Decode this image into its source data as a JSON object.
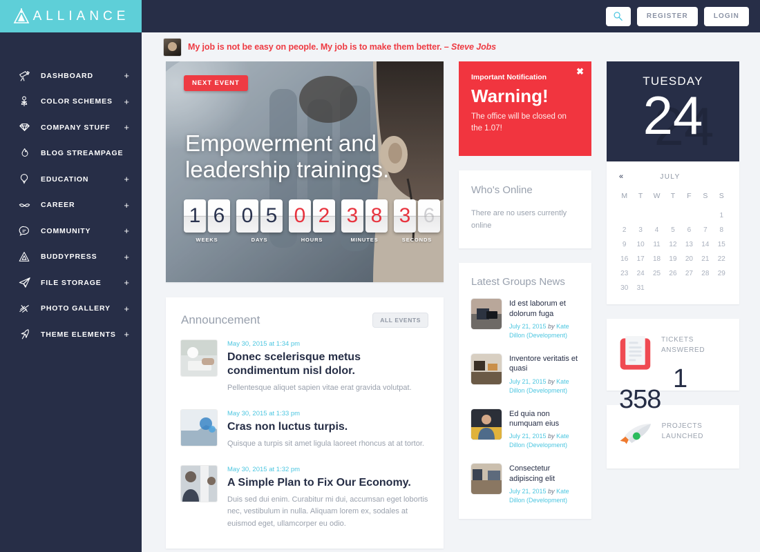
{
  "brand": {
    "name": "ALLIANCE",
    "accent": "#5ecfd8",
    "dark": "#272e47",
    "red": "#ee3b43",
    "cyan": "#4cc6e0"
  },
  "topbar": {
    "search_icon": "search-icon",
    "register_label": "REGISTER",
    "login_label": "LOGIN"
  },
  "sidebar": {
    "items": [
      {
        "label": "DASHBOARD",
        "icon": "telescope-icon",
        "plus": "+"
      },
      {
        "label": "COLOR SCHEMES",
        "icon": "flower-icon",
        "plus": "+"
      },
      {
        "label": "COMPANY STUFF",
        "icon": "diamond-icon",
        "plus": "+"
      },
      {
        "label": "BLOG STREAMPAGE",
        "icon": "flame-icon",
        "plus": ""
      },
      {
        "label": "EDUCATION",
        "icon": "balloon-icon",
        "plus": "+"
      },
      {
        "label": "CAREER",
        "icon": "mustache-icon",
        "plus": "+"
      },
      {
        "label": "COMMUNITY",
        "icon": "chat-bubble-icon",
        "plus": "+"
      },
      {
        "label": "BUDDYPRESS",
        "icon": "triangle-icon",
        "plus": "+"
      },
      {
        "label": "FILE STORAGE",
        "icon": "paper-plane-icon",
        "plus": "+"
      },
      {
        "label": "PHOTO GALLERY",
        "icon": "slashes-icon",
        "plus": "+"
      },
      {
        "label": "THEME ELEMENTS",
        "icon": "origami-bird-icon",
        "plus": "+"
      }
    ]
  },
  "quote": {
    "text": "My job is not be easy on people. My job is to make them better. – ",
    "author": "Steve Jobs"
  },
  "hero": {
    "badge": "NEXT EVENT",
    "title": "Empowerment and leadership trainings.",
    "counter": [
      {
        "label": "WEEKS",
        "digits": [
          "1",
          "6"
        ],
        "style": "dark"
      },
      {
        "label": "DAYS",
        "digits": [
          "0",
          "5"
        ],
        "style": "dark"
      },
      {
        "label": "HOURS",
        "digits": [
          "0",
          "2"
        ],
        "style": "red"
      },
      {
        "label": "MINUTES",
        "digits": [
          "3",
          "8"
        ],
        "style": "red"
      },
      {
        "label": "SECONDS",
        "digits": [
          "3",
          "6"
        ],
        "style": "red-flip"
      }
    ]
  },
  "announcement": {
    "title": "Announcement",
    "all_events_label": "ALL EVENTS",
    "posts": [
      {
        "date": "May 30, 2015 at 1:34 pm",
        "title": "Donec scelerisque metus condimentum nisl dolor.",
        "desc": "Pellentesque aliquet sapien vitae erat gravida volutpat."
      },
      {
        "date": "May 30, 2015 at 1:33 pm",
        "title": "Cras non luctus turpis.",
        "desc": "Quisque a turpis sit amet ligula laoreet rhoncus at at tortor."
      },
      {
        "date": "May 30, 2015 at 1:32 pm",
        "title": "A Simple Plan to Fix Our Economy.",
        "desc": "Duis sed dui enim. Curabitur mi dui, accumsan eget lobortis nec, vestibulum in nulla. Aliquam lorem ex, sodales at euismod eget, ullamcorper eu odio."
      }
    ]
  },
  "notification": {
    "kicker": "Important Notification",
    "title": "Warning!",
    "text": "The office will be closed on the 1.07!",
    "close_icon": "close-icon"
  },
  "whos_online": {
    "title": "Who's Online",
    "text": "There are no users currently online"
  },
  "latest_groups_news": {
    "title": "Latest Groups News",
    "items": [
      {
        "title": "Id est laborum et dolorum fuga",
        "date": "July 21, 2015",
        "by": "by",
        "author": "Kate Dillon (Development)"
      },
      {
        "title": "Inventore veritatis et quasi",
        "date": "July 21, 2015",
        "by": "by",
        "author": "Kate Dillon (Development)"
      },
      {
        "title": "Ed quia non numquam eius",
        "date": "July 21, 2015",
        "by": "by",
        "author": "Kate Dillon (Development)"
      },
      {
        "title": "Consectetur adipiscing elit",
        "date": "July 21, 2015",
        "by": "by",
        "author": "Kate Dillon (Development)"
      }
    ]
  },
  "day_card": {
    "weekday": "TUESDAY",
    "day_number": "24"
  },
  "calendar": {
    "prev_label": "«",
    "month": "JULY",
    "dow": [
      "M",
      "T",
      "W",
      "T",
      "F",
      "S",
      "S"
    ],
    "lead_blanks": 6,
    "days": [
      1,
      2,
      3,
      4,
      5,
      6,
      7,
      8,
      9,
      10,
      11,
      12,
      13,
      14,
      15,
      16,
      17,
      18,
      19,
      20,
      21,
      22,
      23,
      24,
      25,
      26,
      27,
      28,
      29,
      30,
      31
    ]
  },
  "stats": [
    {
      "icon": "document-icon",
      "label": "TICKETS ANSWERED",
      "value_a": "1",
      "value_b": "358"
    },
    {
      "icon": "rocket-icon",
      "label": "PROJECTS LAUNCHED"
    }
  ]
}
